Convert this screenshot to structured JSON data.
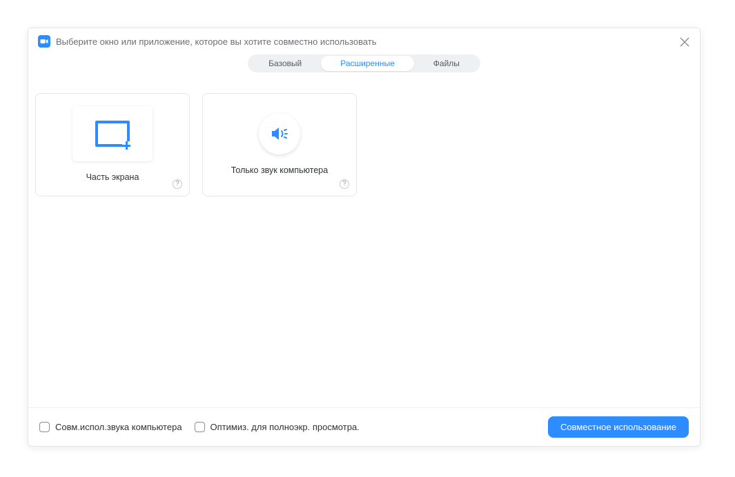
{
  "dialog": {
    "title": "Выберите окно или приложение, которое вы хотите совместно использовать"
  },
  "tabs": {
    "basic": "Базовый",
    "advanced": "Расширенные",
    "files": "Файлы",
    "active": "advanced"
  },
  "options": {
    "portion_of_screen": {
      "label": "Часть экрана"
    },
    "computer_audio_only": {
      "label": "Только звук компьютера"
    }
  },
  "footer": {
    "share_computer_sound": "Совм.испол.звука компьютера",
    "optimize_fullscreen": "Оптимиз. для полноэкр. просмотра.",
    "share_button": "Совместное использование"
  }
}
